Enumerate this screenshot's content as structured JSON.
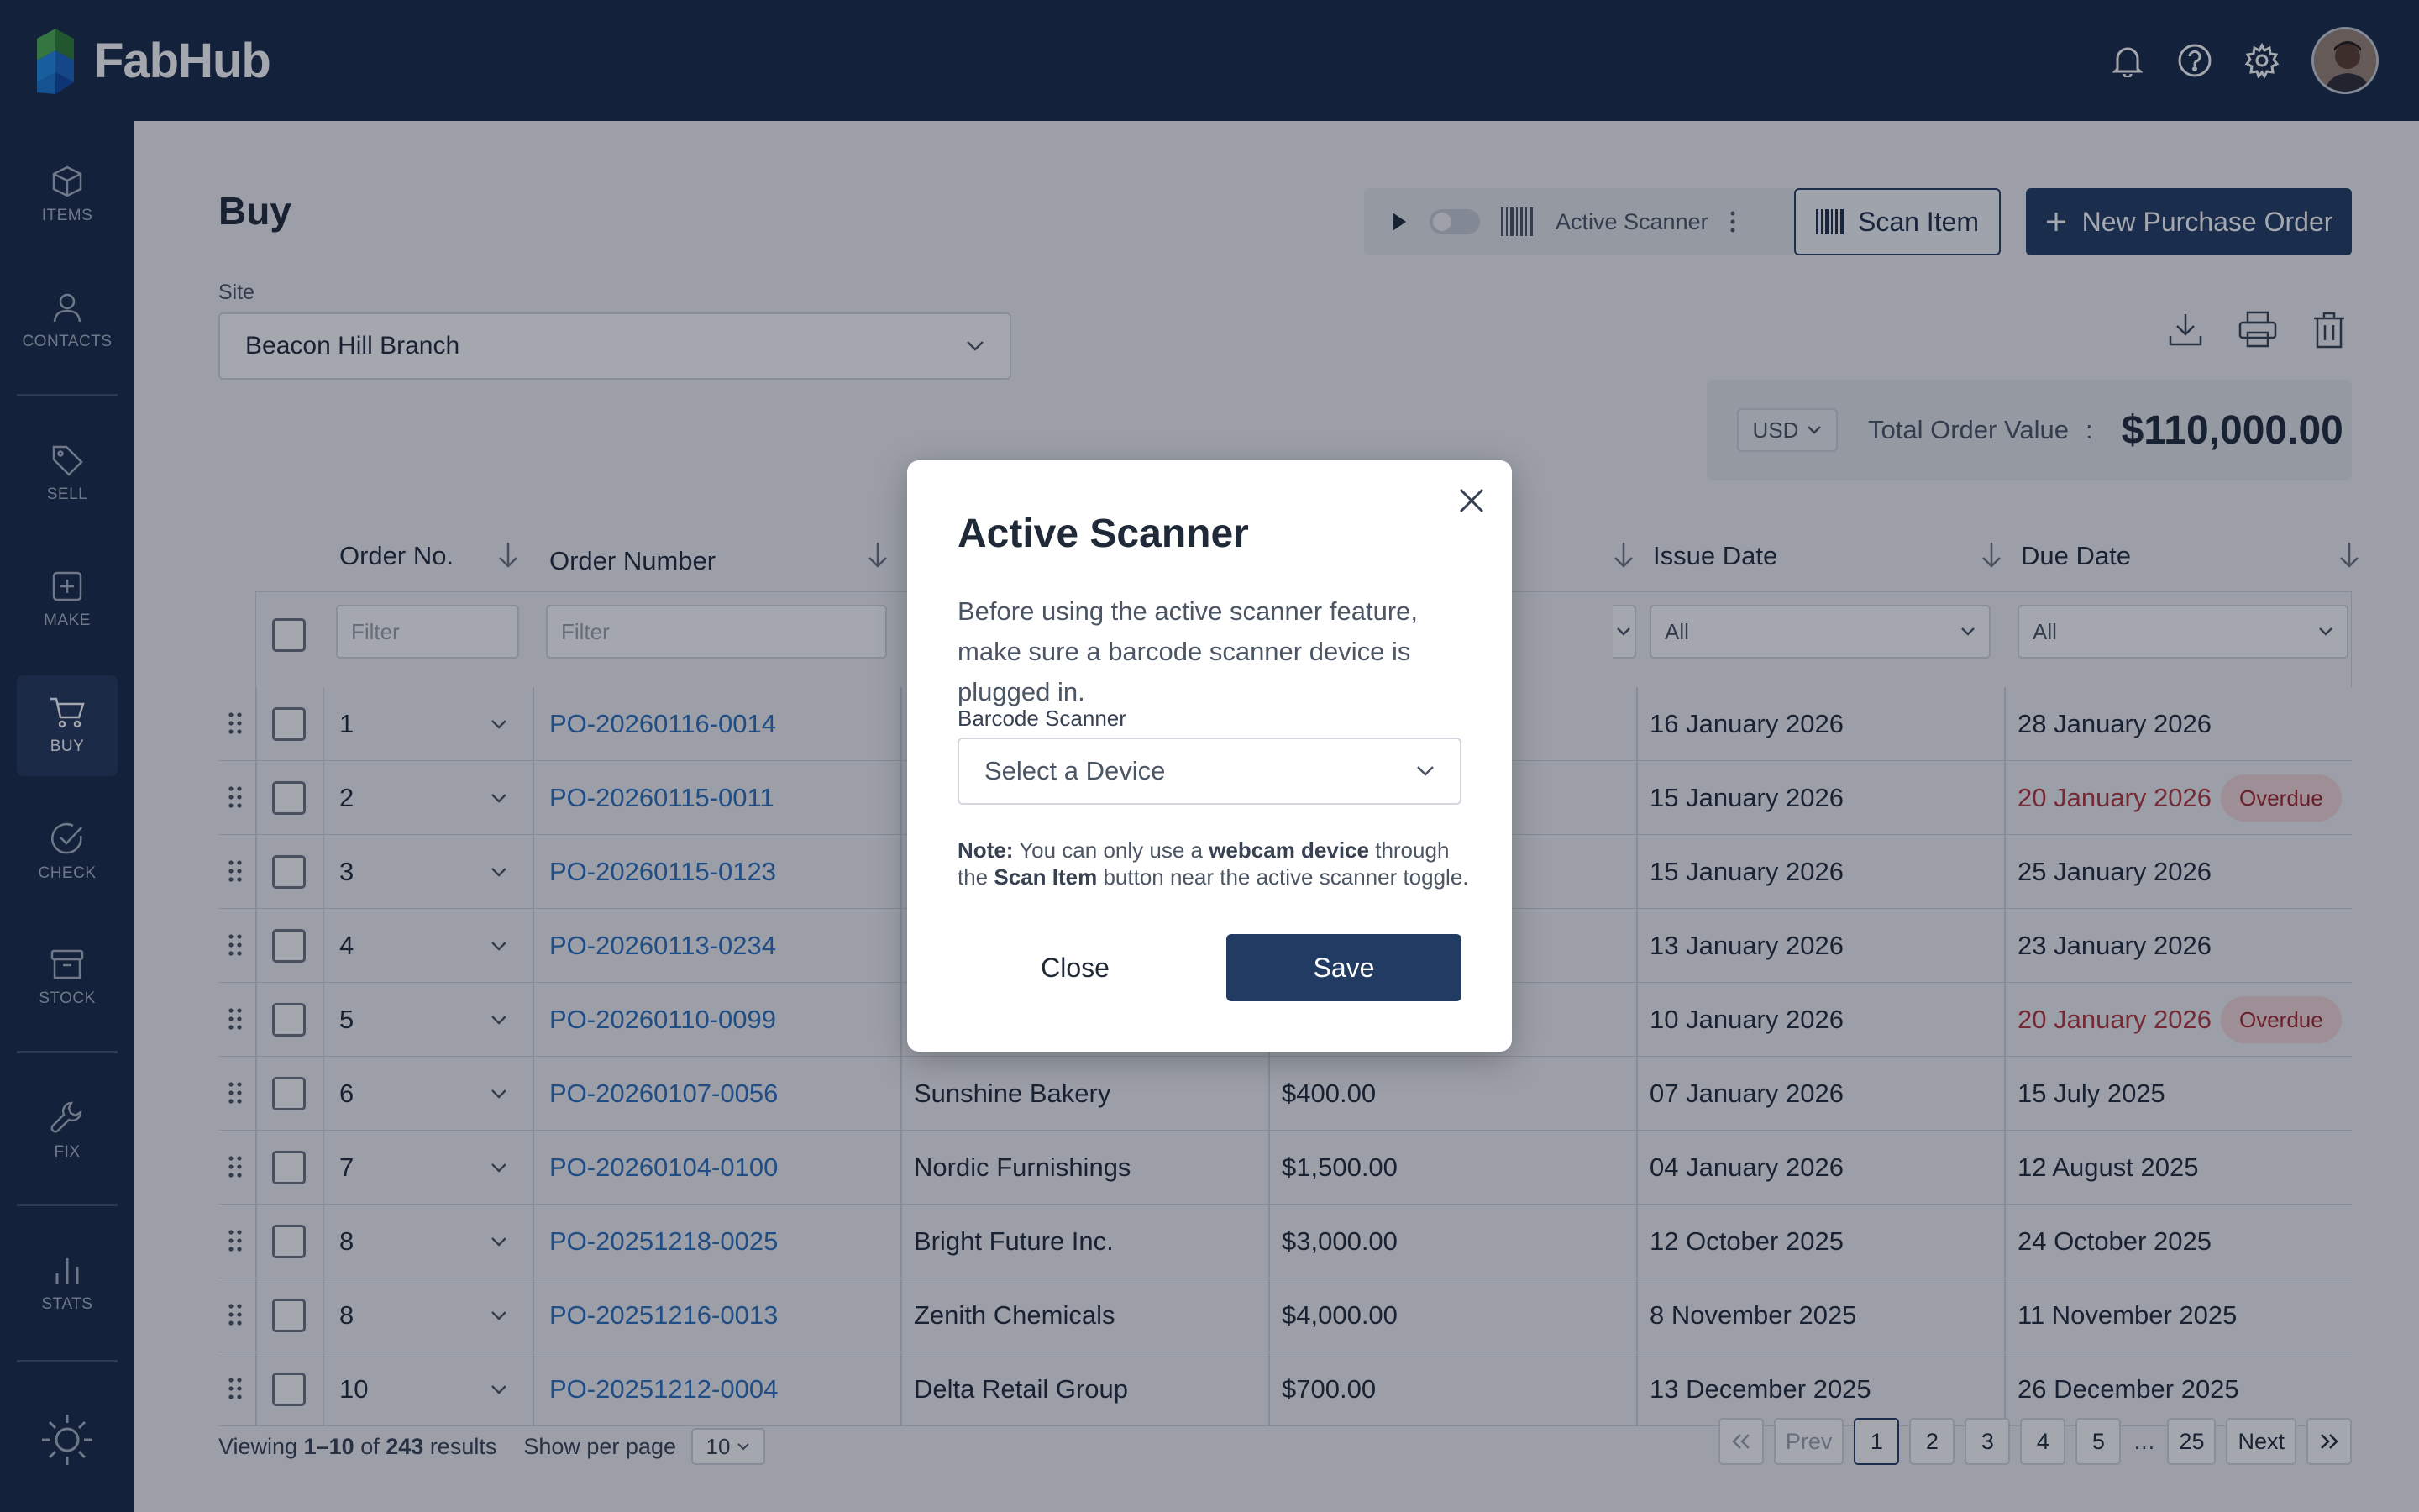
{
  "app": {
    "name": "FabHub"
  },
  "colors": {
    "brand": "#162744",
    "primary": "#223b63",
    "link": "#2c6fbd",
    "overdue": "#b4343a"
  },
  "topbar": {
    "icons": [
      "bell-icon",
      "help-icon",
      "gear-icon",
      "avatar"
    ]
  },
  "sidebar": {
    "items": [
      {
        "label": "ITEMS",
        "icon": "cube-icon",
        "active": false
      },
      {
        "label": "CONTACTS",
        "icon": "person-icon",
        "active": false
      },
      {
        "label": "SELL",
        "icon": "tag-icon",
        "active": false
      },
      {
        "label": "MAKE",
        "icon": "plus-square-icon",
        "active": false
      },
      {
        "label": "BUY",
        "icon": "cart-icon",
        "active": true
      },
      {
        "label": "CHECK",
        "icon": "check-circle-icon",
        "active": false
      },
      {
        "label": "STOCK",
        "icon": "archive-icon",
        "active": false
      },
      {
        "label": "FIX",
        "icon": "wrench-icon",
        "active": false
      },
      {
        "label": "STATS",
        "icon": "bar-chart-icon",
        "active": false
      }
    ],
    "theme_icon": "sun-icon"
  },
  "page": {
    "title": "Buy"
  },
  "toolbar": {
    "scanner_label": "Active Scanner",
    "scan_item_label": "Scan Item",
    "new_po_label": "New Purchase Order"
  },
  "site": {
    "label": "Site",
    "value": "Beacon Hill Branch"
  },
  "totals": {
    "currency": "USD",
    "label": "Total Order Value",
    "separator": ":",
    "value": "$110,000.00"
  },
  "table": {
    "columns": {
      "order_no": "Order No.",
      "order_number": "Order Number",
      "issue_date": "Issue Date",
      "due_date": "Due Date"
    },
    "filters": {
      "placeholder": "Filter",
      "all": "All"
    },
    "rows": [
      {
        "no": "1",
        "po": "PO-20260116-0014",
        "supplier": "",
        "amount": "",
        "issue": "16 January 2026",
        "due": "28 January 2026",
        "overdue": ""
      },
      {
        "no": "2",
        "po": "PO-20260115-0011",
        "supplier": "",
        "amount": "",
        "issue": "15 January 2026",
        "due": "20 January 2026",
        "overdue": "Overdue"
      },
      {
        "no": "3",
        "po": "PO-20260115-0123",
        "supplier": "",
        "amount": "",
        "issue": "15 January 2026",
        "due": "25 January 2026",
        "overdue": ""
      },
      {
        "no": "4",
        "po": "PO-20260113-0234",
        "supplier": "",
        "amount": "",
        "issue": "13 January 2026",
        "due": "23 January 2026",
        "overdue": ""
      },
      {
        "no": "5",
        "po": "PO-20260110-0099",
        "supplier": "",
        "amount": "",
        "issue": "10 January 2026",
        "due": "20 January 2026",
        "overdue": "Overdue"
      },
      {
        "no": "6",
        "po": "PO-20260107-0056",
        "supplier": "Sunshine Bakery",
        "amount": "$400.00",
        "issue": "07 January 2026",
        "due": "15 July 2025",
        "overdue": ""
      },
      {
        "no": "7",
        "po": "PO-20260104-0100",
        "supplier": "Nordic Furnishings",
        "amount": "$1,500.00",
        "issue": "04 January 2026",
        "due": "12 August 2025",
        "overdue": ""
      },
      {
        "no": "8",
        "po": "PO-20251218-0025",
        "supplier": "Bright Future Inc.",
        "amount": "$3,000.00",
        "issue": "12 October 2025",
        "due": "24 October 2025",
        "overdue": ""
      },
      {
        "no": "8",
        "po": "PO-20251216-0013",
        "supplier": "Zenith Chemicals",
        "amount": "$4,000.00",
        "issue": "8 November 2025",
        "due": "11 November 2025",
        "overdue": ""
      },
      {
        "no": "10",
        "po": "PO-20251212-0004",
        "supplier": "Delta Retail Group",
        "amount": "$700.00",
        "issue": "13 December 2025",
        "due": "26 December 2025",
        "overdue": ""
      }
    ]
  },
  "pagination": {
    "viewing_prefix": "Viewing",
    "range": "1–10",
    "of": "of",
    "total": "243",
    "results": "results",
    "per_page_label": "Show per page",
    "per_page": "10",
    "prev": "Prev",
    "next": "Next",
    "pages": [
      "1",
      "2",
      "3",
      "4",
      "5",
      "…",
      "25"
    ],
    "current": "1"
  },
  "modal": {
    "title": "Active Scanner",
    "description": "Before using the active scanner feature, make sure a barcode scanner device is plugged in.",
    "field_label": "Barcode Scanner",
    "select_placeholder": "Select a Device",
    "note_label": "Note:",
    "note_text_1": "You can only use a",
    "note_bold_1": "webcam device",
    "note_text_2": "through the",
    "note_bold_2": "Scan Item",
    "note_text_3": "button near the active scanner toggle.",
    "close_label": "Close",
    "save_label": "Save"
  }
}
